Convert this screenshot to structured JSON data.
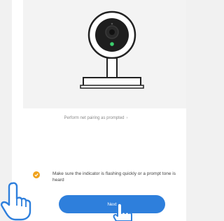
{
  "pairing": {
    "hint_text": "Perform net pairing as prompted",
    "hint_chevron": "›",
    "confirm_text": "Make sure the indicator is flashing quickly or a prompt tone is heard",
    "confirm_checked": true,
    "next_label": "Next"
  },
  "icons": {
    "camera_illustration": "smart-camera-illustration",
    "checkbox": "check-icon",
    "pointer_hands": "pointing-hand-icon"
  },
  "colors": {
    "accent_blue": "#2e7fdc",
    "check_orange": "#f0a21c",
    "camera_indicator": "#3ccf6e"
  }
}
